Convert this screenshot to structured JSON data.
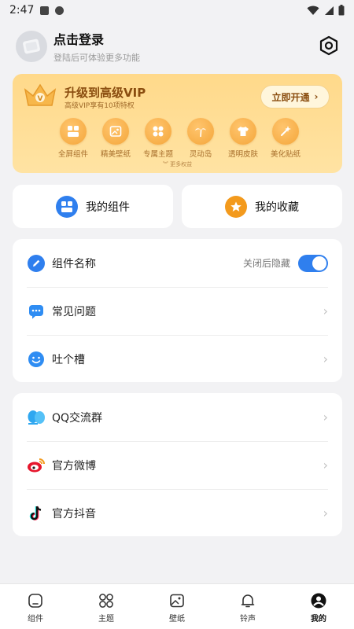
{
  "status_bar": {
    "time": "2:47"
  },
  "header": {
    "title": "点击登录",
    "subtitle": "登陆后可体验更多功能"
  },
  "vip": {
    "title": "升级到高级VIP",
    "subtitle": "高级VIP享有10项特权",
    "open_label": "立即开通",
    "perks": [
      {
        "label": "全屏组件",
        "icon": "widget-icon"
      },
      {
        "label": "精美壁纸",
        "icon": "wallpaper-icon"
      },
      {
        "label": "专属主题",
        "icon": "theme-icon"
      },
      {
        "label": "灵动岛",
        "icon": "island-icon"
      },
      {
        "label": "透明皮肤",
        "icon": "shirt-icon"
      },
      {
        "label": "美化贴纸",
        "icon": "wand-icon"
      }
    ],
    "more_label": "更多权益",
    "accent": "#8a4d0f"
  },
  "quick": {
    "widgets_label": "我的组件",
    "favorites_label": "我的收藏"
  },
  "settings": {
    "rows": [
      {
        "label": "组件名称",
        "hint": "关闭后隐藏",
        "toggle_on": true
      },
      {
        "label": "常见问题"
      },
      {
        "label": "吐个槽"
      }
    ]
  },
  "community": {
    "rows": [
      {
        "label": "QQ交流群"
      },
      {
        "label": "官方微博"
      },
      {
        "label": "官方抖音"
      }
    ]
  },
  "nav": {
    "items": [
      {
        "label": "组件",
        "icon": "widget-tab-icon"
      },
      {
        "label": "主题",
        "icon": "theme-tab-icon"
      },
      {
        "label": "壁纸",
        "icon": "wallpaper-tab-icon"
      },
      {
        "label": "铃声",
        "icon": "bell-icon"
      },
      {
        "label": "我的",
        "icon": "profile-icon"
      }
    ],
    "active_index": 4
  },
  "colors": {
    "primary_blue": "#2f7fee",
    "star_orange": "#f39a1d"
  }
}
